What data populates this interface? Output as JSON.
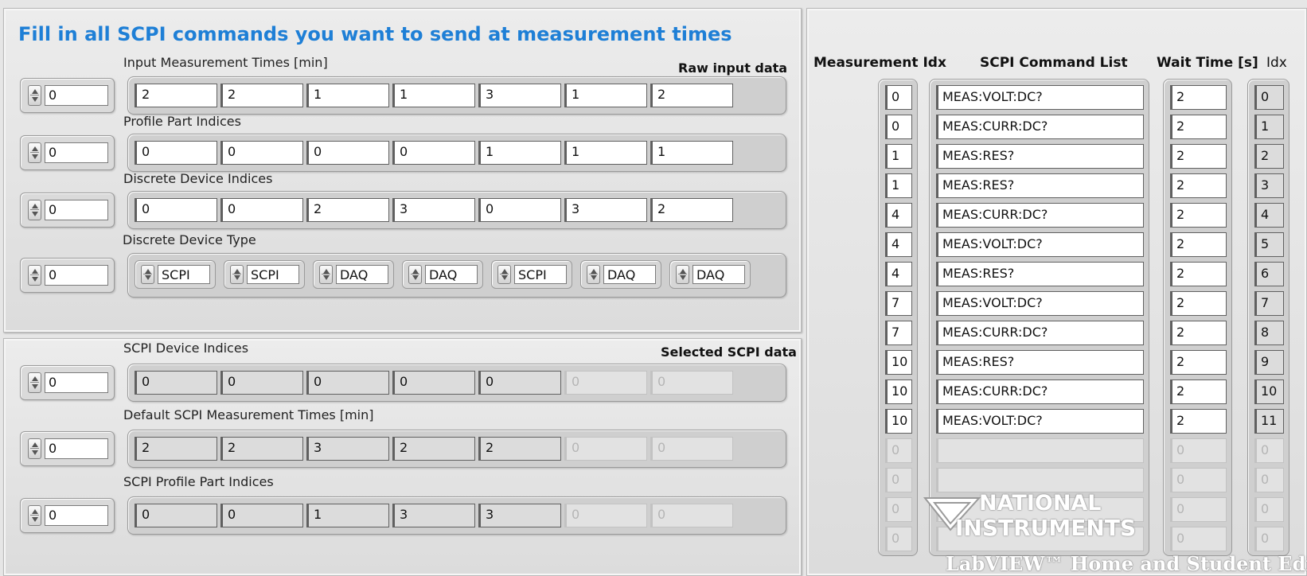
{
  "heading": "Fill in all SCPI commands you want to send at measurement times",
  "raw_input_label": "Raw input data",
  "selected_label": "Selected SCPI data",
  "left_arrays": [
    {
      "label": "Input Measurement Times [min]",
      "index": "0",
      "values": [
        "2",
        "2",
        "1",
        "1",
        "3",
        "1",
        "2"
      ]
    },
    {
      "label": "Profile Part Indices",
      "index": "0",
      "values": [
        "0",
        "0",
        "0",
        "0",
        "1",
        "1",
        "1"
      ]
    },
    {
      "label": "Discrete Device Indices",
      "index": "0",
      "values": [
        "0",
        "0",
        "2",
        "3",
        "0",
        "3",
        "2"
      ]
    }
  ],
  "device_type": {
    "label": "Discrete Device Type",
    "index": "0",
    "values": [
      "SCPI",
      "SCPI",
      "DAQ",
      "DAQ",
      "SCPI",
      "DAQ",
      "DAQ"
    ]
  },
  "selected_arrays": [
    {
      "label": "SCPI Device Indices",
      "index": "0",
      "values": [
        "0",
        "0",
        "0",
        "0",
        "0"
      ],
      "dim": [
        "0",
        "0"
      ]
    },
    {
      "label": "Default SCPI Measurement Times [min]",
      "index": "0",
      "values": [
        "2",
        "2",
        "3",
        "2",
        "2"
      ],
      "dim": [
        "0",
        "0"
      ]
    },
    {
      "label": "SCPI Profile Part Indices",
      "index": "0",
      "values": [
        "0",
        "0",
        "1",
        "3",
        "3"
      ],
      "dim": [
        "0",
        "0"
      ]
    }
  ],
  "right_headers": {
    "meas_idx": "Measurement Idx",
    "cmd": "SCPI Command List",
    "wait": "Wait Time [s]",
    "idx": "Idx"
  },
  "meas_idx": [
    "0",
    "0",
    "1",
    "1",
    "4",
    "4",
    "4",
    "7",
    "7",
    "10",
    "10",
    "10"
  ],
  "commands": [
    "MEAS:VOLT:DC?",
    "MEAS:CURR:DC?",
    "MEAS:RES?",
    "MEAS:RES?",
    "MEAS:CURR:DC?",
    "MEAS:VOLT:DC?",
    "MEAS:RES?",
    "MEAS:VOLT:DC?",
    "MEAS:CURR:DC?",
    "MEAS:RES?",
    "MEAS:CURR:DC?",
    "MEAS:VOLT:DC?"
  ],
  "wait_times": [
    "2",
    "2",
    "2",
    "2",
    "2",
    "2",
    "2",
    "2",
    "2",
    "2",
    "2",
    "2"
  ],
  "idx": [
    "0",
    "1",
    "2",
    "3",
    "4",
    "5",
    "6",
    "7",
    "8",
    "9",
    "10",
    "11"
  ],
  "empty_value": "0",
  "watermark": {
    "line1": "NATIONAL",
    "line2": "INSTRUMENTS",
    "line3": "LabVIEW™ Home and Student Editio"
  },
  "colors": {
    "heading": "#1e7fd6",
    "panel": "#e6e6e6"
  }
}
